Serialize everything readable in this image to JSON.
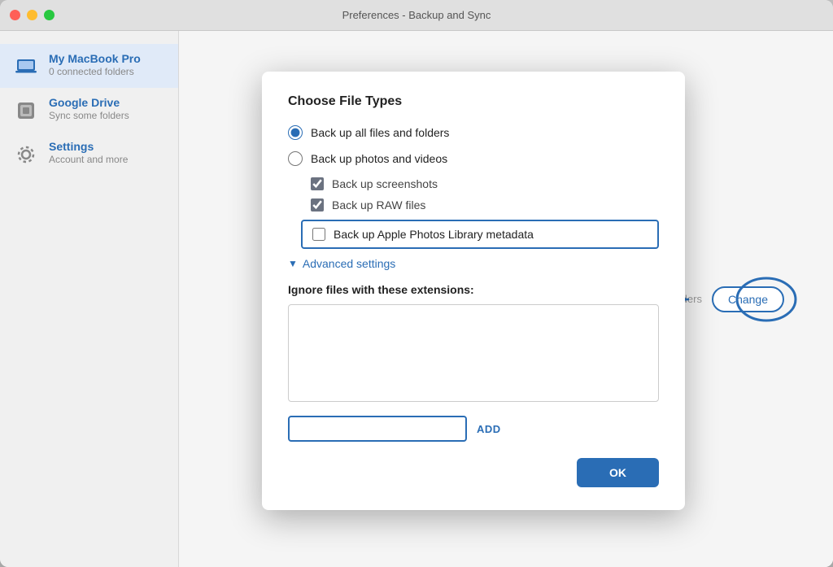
{
  "window": {
    "title": "Preferences - Backup and Sync"
  },
  "sidebar": {
    "items": [
      {
        "id": "macbook",
        "title": "My MacBook Pro",
        "subtitle": "0 connected folders",
        "icon": "laptop-icon",
        "active": true
      },
      {
        "id": "google-drive",
        "title": "Google Drive",
        "subtitle": "Sync some folders",
        "icon": "drive-icon",
        "active": false
      },
      {
        "id": "settings",
        "title": "Settings",
        "subtitle": "Account and more",
        "icon": "gear-icon",
        "active": false
      }
    ]
  },
  "dialog": {
    "title": "Choose File Types",
    "radio_options": [
      {
        "id": "all-files",
        "label": "Back up all files and folders",
        "checked": true
      },
      {
        "id": "photos-videos",
        "label": "Back up photos and videos",
        "checked": false
      }
    ],
    "checkboxes": [
      {
        "id": "screenshots",
        "label": "Back up screenshots",
        "checked": true,
        "highlighted": false
      },
      {
        "id": "raw-files",
        "label": "Back up RAW files",
        "checked": true,
        "highlighted": false
      },
      {
        "id": "apple-photos",
        "label": "Back up Apple Photos Library metadata",
        "checked": false,
        "highlighted": true
      }
    ],
    "advanced_settings": {
      "label": "Advanced settings",
      "expanded": true
    },
    "ignore_extensions": {
      "label": "Ignore files with these extensions:",
      "value": "",
      "placeholder": ""
    },
    "add_input": {
      "placeholder": "",
      "value": ""
    },
    "add_button_label": "ADD",
    "ok_button_label": "OK"
  },
  "background": {
    "text": "es and folders",
    "change_label": "Change"
  }
}
